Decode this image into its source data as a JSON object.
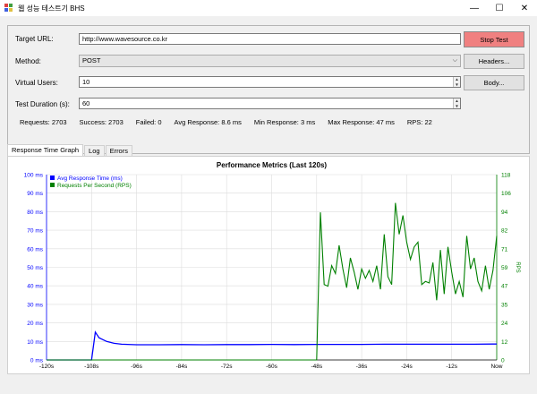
{
  "window": {
    "title": "웹 성능 테스트기 BHS",
    "controls": {
      "minimize": "—",
      "maximize": "☐",
      "close": "✕"
    }
  },
  "form": {
    "target_url_label": "Target URL:",
    "target_url_value": "http://www.wavesource.co.kr",
    "method_label": "Method:",
    "method_value": "POST",
    "virtual_users_label": "Virtual Users:",
    "virtual_users_value": "10",
    "duration_label": "Test Duration (s):",
    "duration_value": "60"
  },
  "buttons": {
    "stop_test": "Stop Test",
    "headers": "Headers...",
    "body": "Body..."
  },
  "stats": {
    "requests": "Requests: 2703",
    "success": "Success: 2703",
    "failed": "Failed: 0",
    "avg_response": "Avg Response: 8.6 ms",
    "min_response": "Min Response: 3 ms",
    "max_response": "Max Response: 47 ms",
    "rps": "RPS: 22"
  },
  "tabs": [
    "Response Time Graph",
    "Log",
    "Errors"
  ],
  "colors": {
    "stop_button": "#f08080",
    "response_series": "#0000ff",
    "rps_series": "#008000"
  },
  "chart_data": {
    "type": "line",
    "title": "Performance Metrics (Last 120s)",
    "legend_position": "top-left",
    "grid": true,
    "x_ticks": [
      "-120s",
      "-108s",
      "-96s",
      "-84s",
      "-72s",
      "-60s",
      "-48s",
      "-36s",
      "-24s",
      "-12s",
      "Now"
    ],
    "xlim": [
      -120,
      0
    ],
    "y_left": {
      "ylim": [
        0,
        100
      ],
      "ticks": [
        "0 ms",
        "10 ms",
        "20 ms",
        "30 ms",
        "40 ms",
        "50 ms",
        "60 ms",
        "70 ms",
        "80 ms",
        "90 ms",
        "100 ms"
      ]
    },
    "y_right": {
      "label": "RPS",
      "ylim": [
        0,
        118
      ],
      "ticks": [
        "0",
        "12",
        "24",
        "35",
        "47",
        "59",
        "71",
        "82",
        "94",
        "106",
        "118"
      ]
    },
    "series": [
      {
        "name": "Avg Response Time (ms)",
        "axis": "left",
        "x": [
          -120,
          -108,
          -107,
          -106,
          -104,
          -102,
          -100,
          -96,
          -90,
          -84,
          -78,
          -72,
          -66,
          -60,
          -54,
          -48,
          -42,
          -36,
          -30,
          -24,
          -18,
          -12,
          -6,
          -1,
          0
        ],
        "y": [
          0,
          0,
          15,
          12,
          10,
          9,
          8.5,
          8.2,
          8.2,
          8.3,
          8.2,
          8.3,
          8.3,
          8.4,
          8.3,
          8.4,
          8.4,
          8.4,
          8.5,
          8.5,
          8.5,
          8.5,
          8.5,
          8.6,
          8.6
        ]
      },
      {
        "name": "Requests Per Second (RPS)",
        "axis": "right",
        "x": [
          -120,
          -48,
          -47,
          -46,
          -45,
          -44,
          -43,
          -42,
          -41,
          -40,
          -39,
          -38,
          -37,
          -36,
          -35,
          -34,
          -33,
          -32,
          -31,
          -30,
          -29,
          -28,
          -27,
          -26,
          -25,
          -24,
          -23,
          -22,
          -21,
          -20,
          -19,
          -18,
          -17,
          -16,
          -15,
          -14,
          -13,
          -12,
          -11,
          -10,
          -9,
          -8,
          -7,
          -6,
          -5,
          -4,
          -3,
          -2,
          -1,
          0
        ],
        "y": [
          0,
          0,
          94,
          48,
          47,
          60,
          55,
          73,
          58,
          46,
          65,
          56,
          45,
          58,
          52,
          57,
          50,
          60,
          45,
          80,
          53,
          48,
          100,
          80,
          92,
          75,
          64,
          72,
          75,
          48,
          50,
          49,
          62,
          38,
          70,
          42,
          72,
          56,
          42,
          50,
          40,
          79,
          58,
          65,
          50,
          44,
          60,
          45,
          57,
          79
        ]
      }
    ]
  }
}
